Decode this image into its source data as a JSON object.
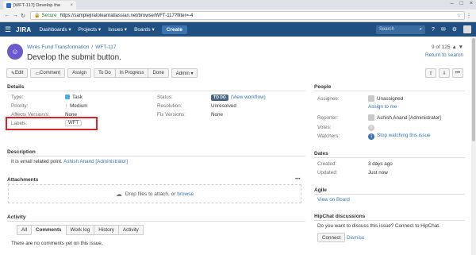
{
  "browser": {
    "tab_title": "[WFT-117] Develop the",
    "secure_label": "Secure",
    "url": "https://samplejiratolearnatlassian.net/browse/WFT-117?filter=-4"
  },
  "header": {
    "logo": "JIRA",
    "nav": [
      "Dashboards ▾",
      "Projects ▾",
      "Issues ▾",
      "Boards ▾"
    ],
    "create_label": "Create",
    "search_placeholder": "Search"
  },
  "issue": {
    "project": "Wires Fund Transformation",
    "key": "WFT-117",
    "summary": "Develop the submit button.",
    "pager": "9 of 125",
    "return_link": "Return to search"
  },
  "toolbar": {
    "edit": "Edit",
    "comment": "Comment",
    "assign": "Assign",
    "todo": "To Do",
    "in_progress": "In Progress",
    "done": "Done",
    "admin": "Admin ▾"
  },
  "details": {
    "title": "Details",
    "type_label": "Type:",
    "type_value": "Task",
    "priority_label": "Priority:",
    "priority_value": "Medium",
    "affects_label": "Affects Version/s:",
    "affects_value": "None",
    "labels_label": "Labels:",
    "labels_value": "WFT",
    "status_label": "Status:",
    "status_value": "TO DO",
    "status_link": "(View workflow)",
    "resolution_label": "Resolution:",
    "resolution_value": "Unresolved",
    "fix_label": "Fix Versions:",
    "fix_value": "None"
  },
  "description": {
    "title": "Description",
    "text": "It is email related point.",
    "author": "Ashish Anand [Administrator]"
  },
  "attachments": {
    "title": "Attachments",
    "drop_text": "Drop files to attach, or",
    "browse": "browse",
    "more": "•••"
  },
  "activity": {
    "title": "Activity",
    "tabs": [
      "All",
      "Comments",
      "Work log",
      "History",
      "Activity"
    ],
    "empty": "There are no comments yet on this issue."
  },
  "people": {
    "title": "People",
    "assignee_label": "Assignee:",
    "assignee_value": "Unassigned",
    "assign_to_me": "Assign to me",
    "reporter_label": "Reporter:",
    "reporter_value": "Ashish Anand [Administrator]",
    "votes_label": "Votes:",
    "votes_value": "0",
    "watchers_label": "Watchers:",
    "watchers_count": "1",
    "watchers_link": "Stop watching this issue"
  },
  "dates": {
    "title": "Dates",
    "created_label": "Created:",
    "created_value": "3 days ago",
    "updated_label": "Updated:",
    "updated_value": "Just now"
  },
  "agile": {
    "title": "Agile",
    "link": "View on Board"
  },
  "hipchat": {
    "title": "HipChat discussions",
    "text": "Do you want to discuss this issue? Connect to HipChat.",
    "connect": "Connect",
    "dismiss": "Dismiss"
  },
  "colors": {
    "header_bg": "#205081",
    "link": "#3b73af",
    "highlight_box": "#e01f26"
  }
}
